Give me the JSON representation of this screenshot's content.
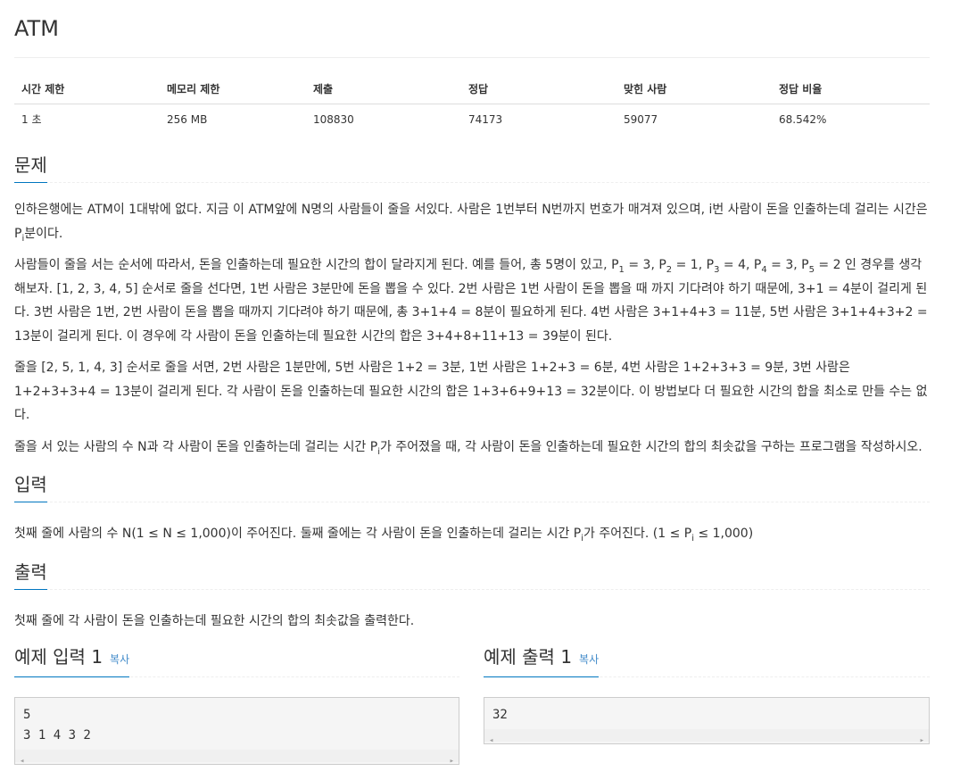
{
  "problem": {
    "title": "ATM"
  },
  "info_table": {
    "headers": [
      "시간 제한",
      "메모리 제한",
      "제출",
      "정답",
      "맞힌 사람",
      "정답 비율"
    ],
    "values": [
      "1 초",
      "256 MB",
      "108830",
      "74173",
      "59077",
      "68.542%"
    ]
  },
  "sections": {
    "description": {
      "heading": "문제",
      "p1a": "인하은행에는 ATM이 1대밖에 없다. 지금 이 ATM앞에 N명의 사람들이 줄을 서있다. 사람은 1번부터 N번까지 번호가 매겨져 있으며, i번 사람이 돈을 인출하는데 걸리는 시간은 P",
      "p1sub": "i",
      "p1b": "분이다.",
      "p2a": "사람들이 줄을 서는 순서에 따라서, 돈을 인출하는데 필요한 시간의 합이 달라지게 된다. 예를 들어, 총 5명이 있고, P",
      "p2s1": "1",
      "p2b": " = 3, P",
      "p2s2": "2",
      "p2c": " = 1, P",
      "p2s3": "3",
      "p2d": " = 4, P",
      "p2s4": "4",
      "p2e": " = 3, P",
      "p2s5": "5",
      "p2f": " = 2 인 경우를 생각해보자. [1, 2, 3, 4, 5] 순서로 줄을 선다면, 1번 사람은 3분만에 돈을 뽑을 수 있다. 2번 사람은 1번 사람이 돈을 뽑을 때 까지 기다려야 하기 때문에, 3+1 = 4분이 걸리게 된다. 3번 사람은 1번, 2번 사람이 돈을 뽑을 때까지 기다려야 하기 때문에, 총 3+1+4 = 8분이 필요하게 된다. 4번 사람은 3+1+4+3 = 11분, 5번 사람은 3+1+4+3+2 = 13분이 걸리게 된다. 이 경우에 각 사람이 돈을 인출하는데 필요한 시간의 합은 3+4+8+11+13 = 39분이 된다.",
      "p3": "줄을 [2, 5, 1, 4, 3] 순서로 줄을 서면, 2번 사람은 1분만에, 5번 사람은 1+2 = 3분, 1번 사람은 1+2+3 = 6분, 4번 사람은 1+2+3+3 = 9분, 3번 사람은 1+2+3+3+4 = 13분이 걸리게 된다. 각 사람이 돈을 인출하는데 필요한 시간의 합은 1+3+6+9+13 = 32분이다. 이 방법보다 더 필요한 시간의 합을 최소로 만들 수는 없다.",
      "p4a": "줄을 서 있는 사람의 수 N과 각 사람이 돈을 인출하는데 걸리는 시간 P",
      "p4sub": "i",
      "p4b": "가 주어졌을 때, 각 사람이 돈을 인출하는데 필요한 시간의 합의 최솟값을 구하는 프로그램을 작성하시오."
    },
    "input": {
      "heading": "입력",
      "pa": "첫째 줄에 사람의 수 N(1 ≤ N ≤ 1,000)이 주어진다. 둘째 줄에는 각 사람이 돈을 인출하는데 걸리는 시간 P",
      "psub1": "i",
      "pb": "가 주어진다. (1 ≤ P",
      "psub2": "i",
      "pc": " ≤ 1,000)"
    },
    "output": {
      "heading": "출력",
      "p": "첫째 줄에 각 사람이 돈을 인출하는데 필요한 시간의 합의 최솟값을 출력한다."
    }
  },
  "samples": {
    "input": {
      "heading": "예제 입력 1",
      "copy_label": "복사",
      "content": "5\n3 1 4 3 2"
    },
    "output": {
      "heading": "예제 출력 1",
      "copy_label": "복사",
      "content": "32"
    },
    "scroll_left": "◂",
    "scroll_right": "▸"
  },
  "colors": {
    "accent": "#0076c0",
    "link": "#428bca"
  }
}
